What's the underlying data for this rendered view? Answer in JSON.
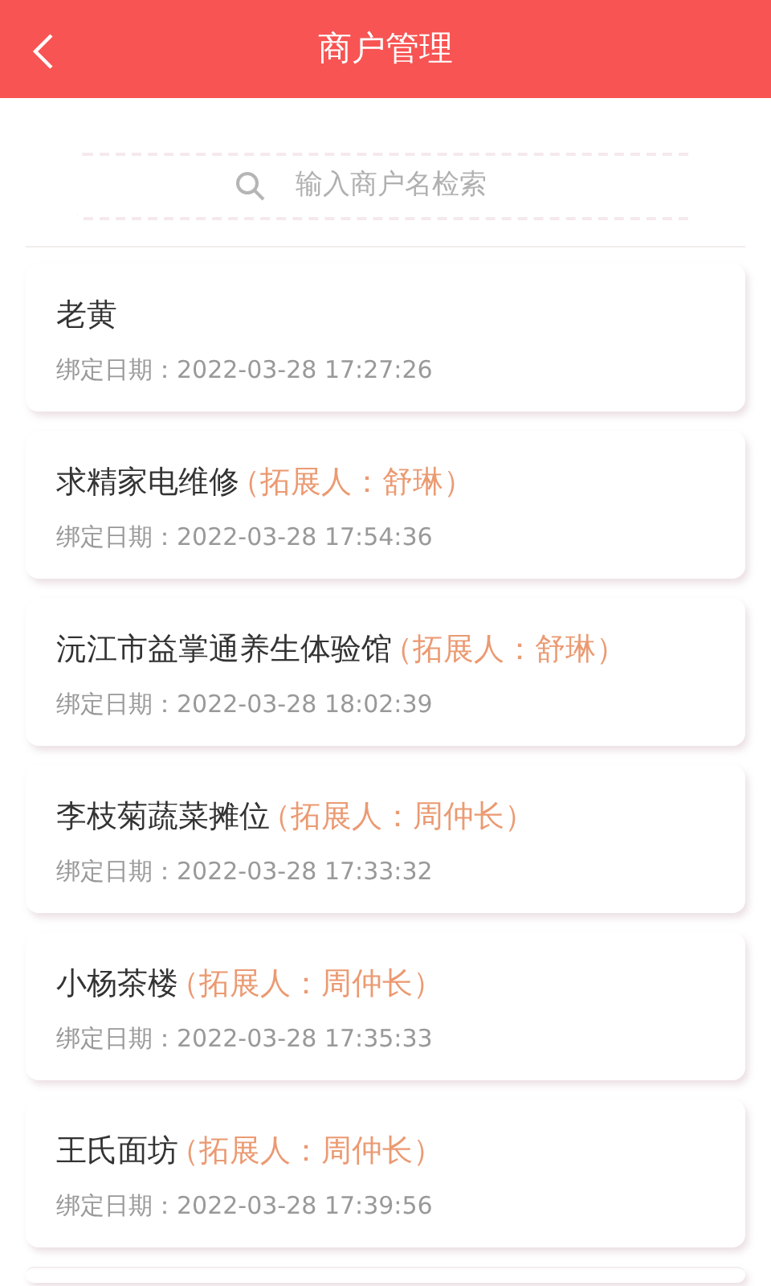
{
  "header": {
    "title": "商户管理"
  },
  "search": {
    "placeholder": "输入商户名检索"
  },
  "merchants": [
    {
      "name": "老黄",
      "date_label": "绑定日期：",
      "date": "2022-03-28 17:27:26"
    },
    {
      "name": "求精家电维修",
      "promoter": "（拓展人：舒琳）",
      "date_label": "绑定日期：",
      "date": "2022-03-28 17:54:36"
    },
    {
      "name": "沅江市益掌通养生体验馆",
      "promoter": "（拓展人：舒琳）",
      "date_label": "绑定日期：",
      "date": "2022-03-28 18:02:39"
    },
    {
      "name": "李枝菊蔬菜摊位",
      "promoter": "（拓展人：周仲长）",
      "date_label": "绑定日期：",
      "date": "2022-03-28 17:33:32"
    },
    {
      "name": "小杨茶楼",
      "promoter": "（拓展人：周仲长）",
      "date_label": "绑定日期：",
      "date": "2022-03-28 17:35:33"
    },
    {
      "name": "王氏面坊",
      "promoter": "（拓展人：周仲长）",
      "date_label": "绑定日期：",
      "date": "2022-03-28 17:39:56"
    }
  ]
}
